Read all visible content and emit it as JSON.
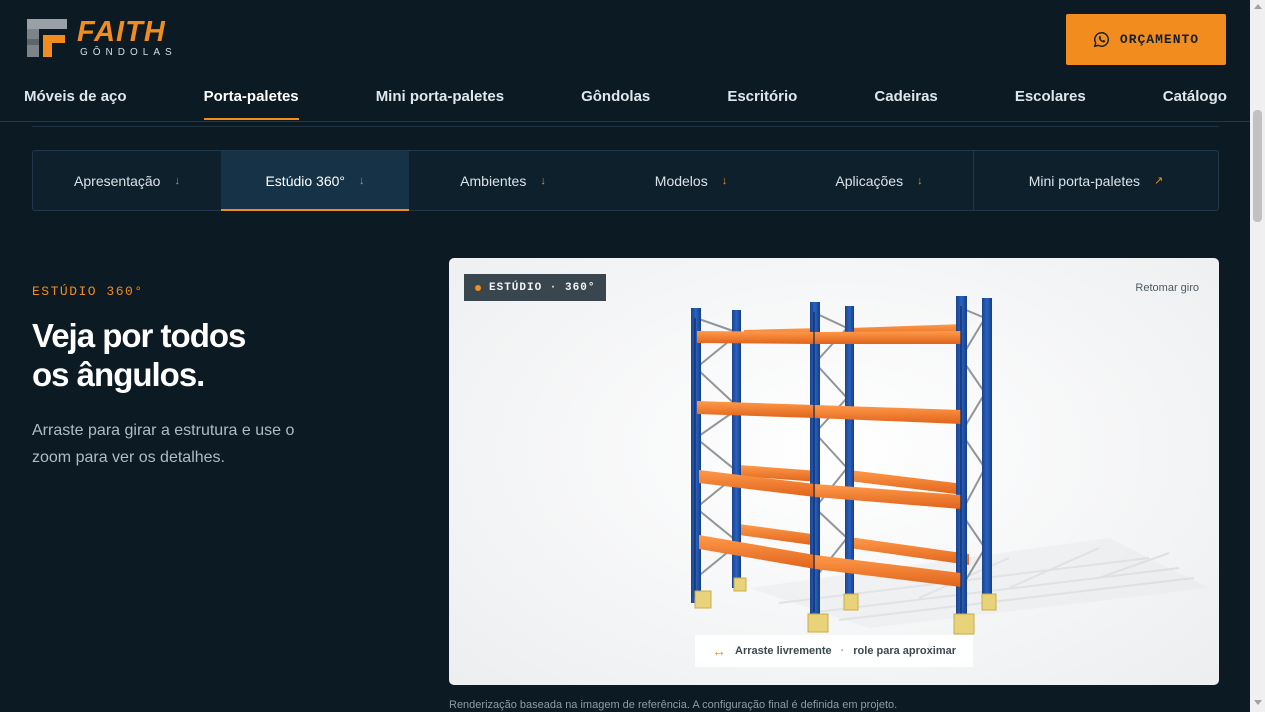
{
  "colors": {
    "accent": "#f28c1e",
    "background": "#0b1a23",
    "upright": "#1f4fa3",
    "beam": "#f07a2a",
    "foot": "#e8d27a"
  },
  "logo": {
    "name": "FAITH",
    "sub": "GÔNDOLAS",
    "icon": "faith-logo-mark"
  },
  "cta": {
    "label": "ORÇAMENTO",
    "icon": "whatsapp-icon"
  },
  "nav": {
    "items": [
      {
        "label": "Móveis de aço"
      },
      {
        "label": "Porta-paletes",
        "active": true
      },
      {
        "label": "Mini porta-paletes"
      },
      {
        "label": "Gôndolas"
      },
      {
        "label": "Escritório"
      },
      {
        "label": "Cadeiras"
      },
      {
        "label": "Escolares"
      },
      {
        "label": "Catálogo"
      }
    ]
  },
  "subtabs": [
    {
      "label": "Apresentação",
      "icon": "arrow-down-icon",
      "glyph": "↓"
    },
    {
      "label": "Estúdio 360°",
      "icon": "arrow-down-icon",
      "glyph": "↓",
      "active": true
    },
    {
      "label": "Ambientes",
      "icon": "arrow-down-icon",
      "glyph": "↓"
    },
    {
      "label": "Modelos",
      "icon": "arrow-down-icon",
      "glyph": "↓"
    },
    {
      "label": "Aplicações",
      "icon": "arrow-down-icon",
      "glyph": "↓"
    },
    {
      "label": "Mini porta-paletes",
      "icon": "external-arrow-icon",
      "glyph": "↗"
    }
  ],
  "section": {
    "eyebrow": "ESTÚDIO 360°",
    "heading_line1": "Veja por todos",
    "heading_line2": "os ângulos.",
    "description": "Arraste para girar a estrutura e use o zoom para ver os detalhes."
  },
  "viewer": {
    "badge": "ESTÚDIO · 360°",
    "reset": "Retomar giro",
    "hint_drag": "Arraste livremente",
    "hint_sep": "·",
    "hint_zoom": "role para aproximar",
    "hint_icon": "↔",
    "caption": "Renderização baseada na imagem de referência. A configuração final é definida em projeto."
  }
}
